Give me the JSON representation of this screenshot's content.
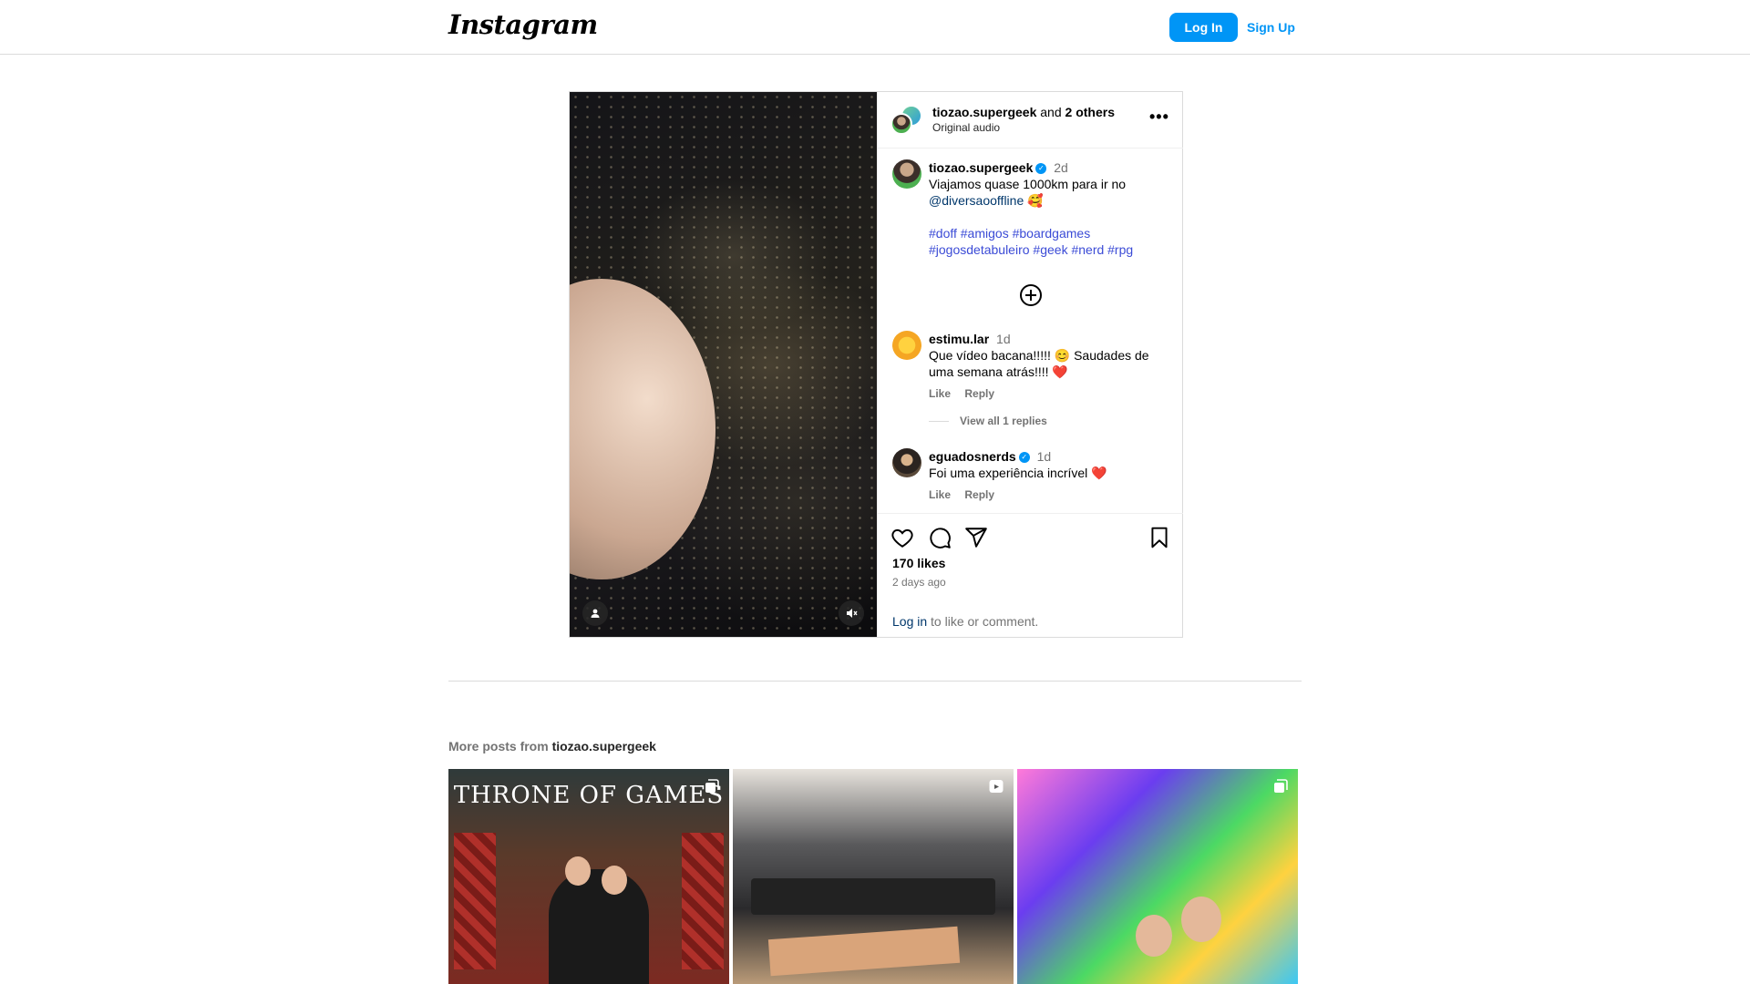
{
  "header": {
    "logo": "Instagram",
    "login_label": "Log In",
    "signup_label": "Sign Up"
  },
  "post": {
    "author": "tiozao.supergeek",
    "collab_joiner": "and",
    "collab_others": "2 others",
    "audio": "Original audio",
    "caption": {
      "username": "tiozao.supergeek",
      "time": "2d",
      "line1": "Viajamos quase 1000km para ir no",
      "mention": "@diversaooffline",
      "mention_emoji": "🥰",
      "hashtags_line1": "#doff #amigos #boardgames",
      "hashtags_line2": "#jogosdetabuleiro #geek #nerd #rpg"
    },
    "comments": [
      {
        "username": "estimu.lar",
        "time": "1d",
        "line1": "Que vídeo bacana!!!!! 😊 Saudades de",
        "line2": "uma semana atrás!!!! ❤️",
        "like_label": "Like",
        "reply_label": "Reply",
        "view_replies": "View all 1 replies"
      },
      {
        "username": "eguadosnerds",
        "time": "1d",
        "line1": "Foi uma experiência incrível ❤️",
        "like_label": "Like",
        "reply_label": "Reply"
      }
    ],
    "likes": "170 likes",
    "posted": "2 days ago",
    "login_link": "Log in",
    "login_suffix": " to like or comment."
  },
  "more_posts": {
    "prefix": "More posts from ",
    "username": "tiozao.supergeek",
    "first_title": "THRONE OF GAMES"
  },
  "icons": [
    "more-icon",
    "add-comment-icon",
    "heart-icon",
    "comment-icon",
    "share-icon",
    "bookmark-icon",
    "user-tag-icon",
    "mute-icon",
    "carousel-icon",
    "reel-icon",
    "verified-icon"
  ],
  "colors": {
    "accent": "#0095f6",
    "link": "#00376b",
    "hashtag": "#3b4bd6",
    "muted": "#737373",
    "border": "#dbdbdb"
  }
}
